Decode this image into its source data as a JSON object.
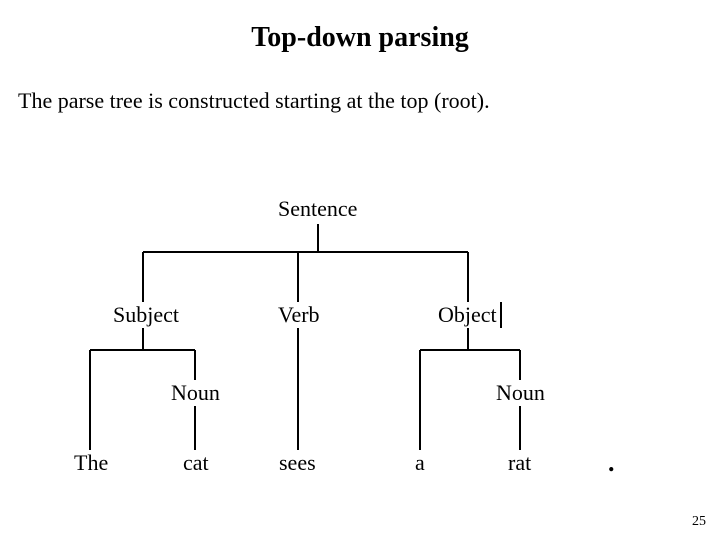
{
  "title": "Top-down parsing",
  "body": "The parse tree is constructed starting at the top  (root).",
  "tree": {
    "sentence": "Sentence",
    "subject": "Subject",
    "verb": "Verb",
    "object": "Object",
    "noun_left": "Noun",
    "noun_right": "Noun",
    "tok_the": "The",
    "tok_cat": "cat",
    "tok_sees": "sees",
    "tok_a": "a",
    "tok_rat": "rat",
    "tok_dot": "."
  },
  "page_number": "25"
}
